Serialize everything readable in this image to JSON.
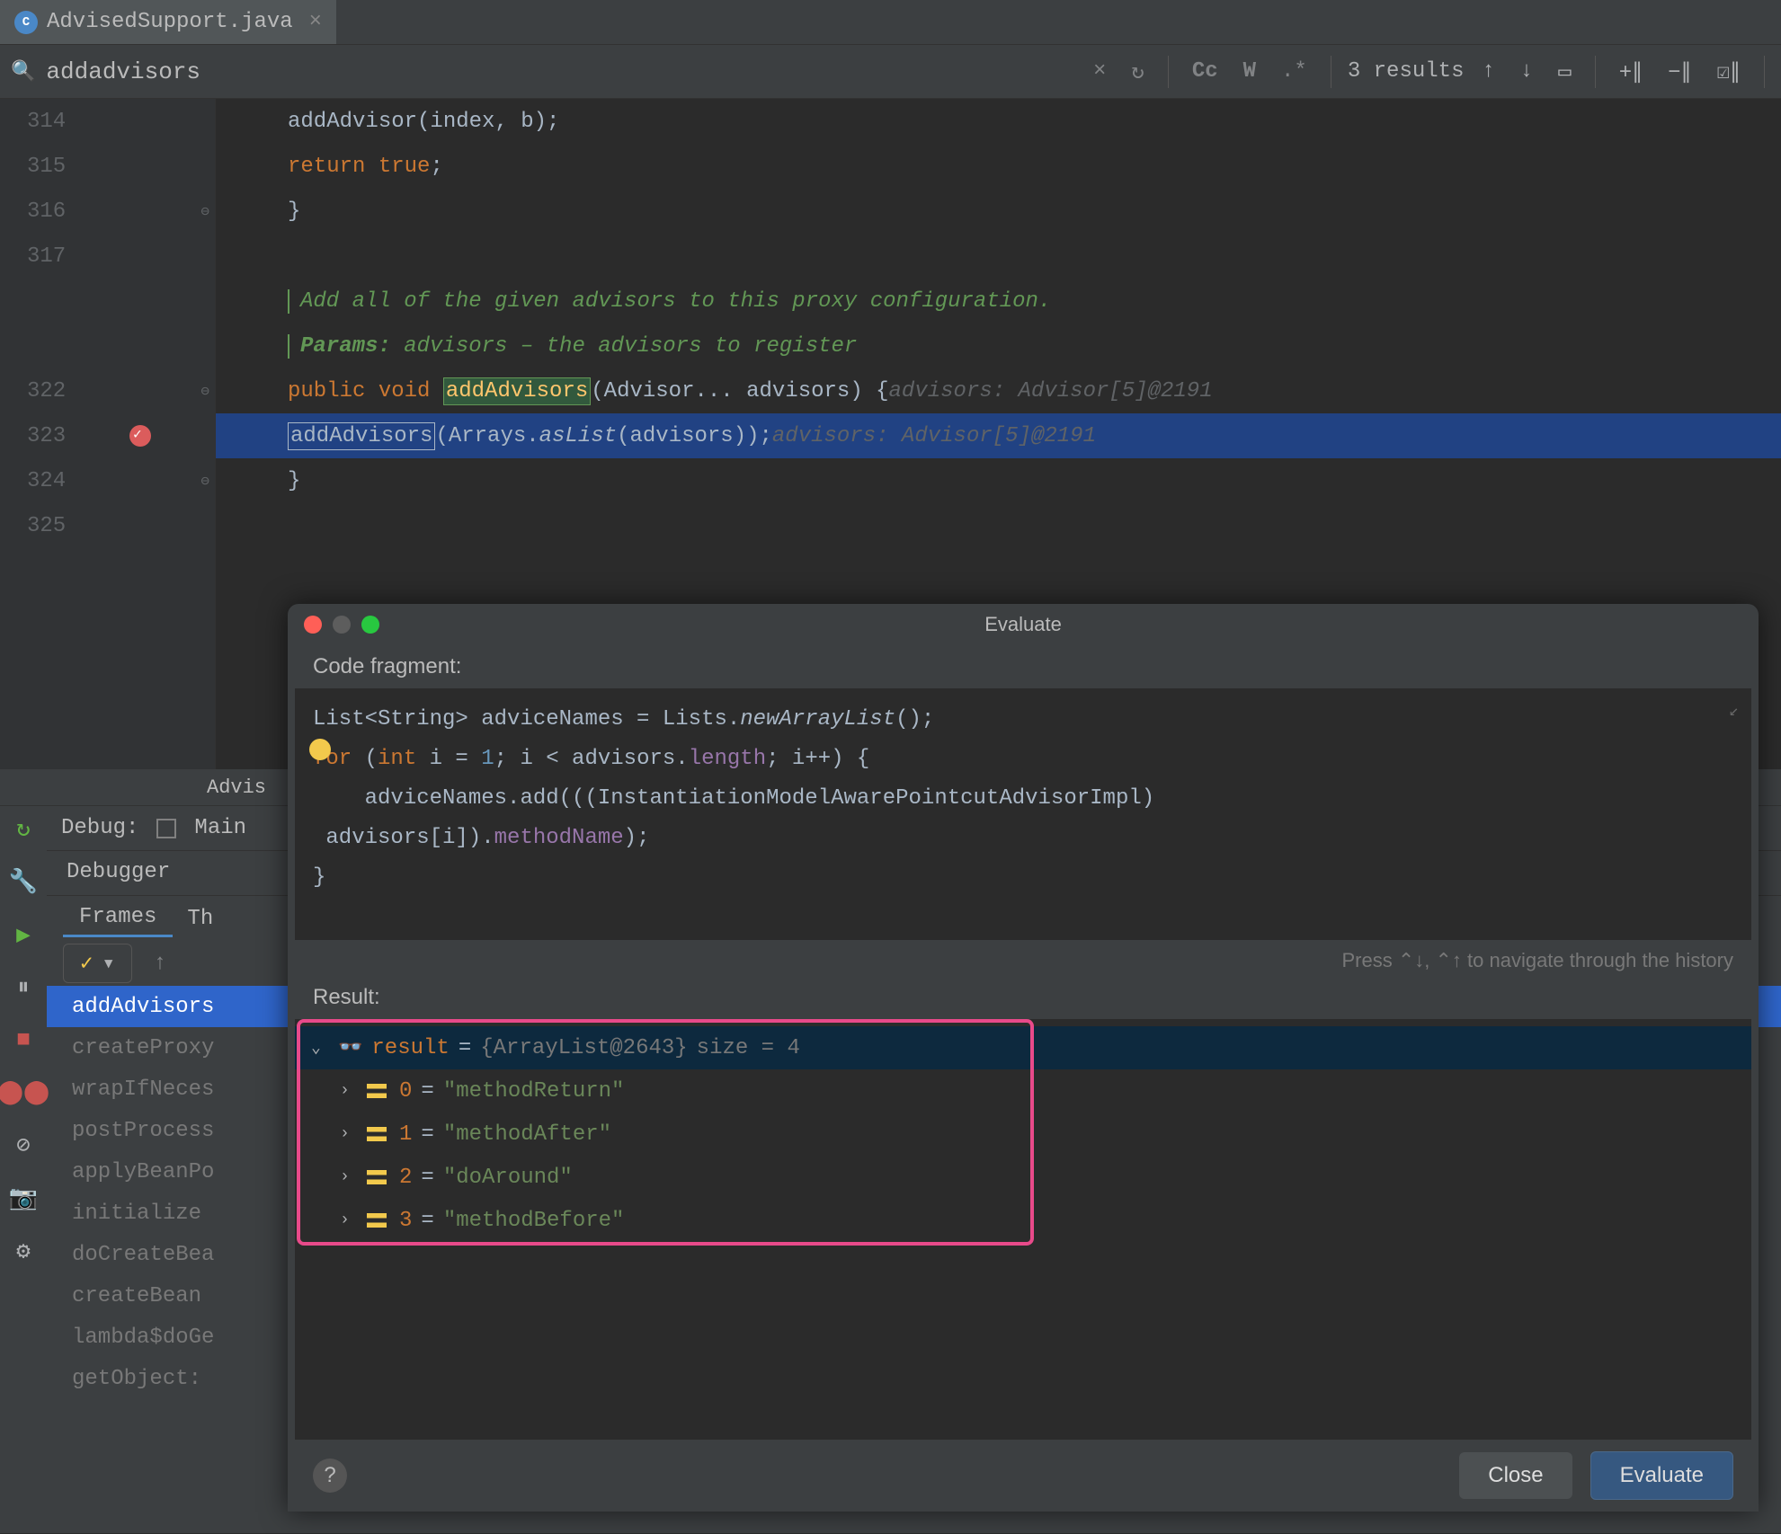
{
  "tab": {
    "label": "AdvisedSupport.java",
    "icon_letter": "C"
  },
  "search": {
    "query": "addadvisors",
    "results_text": "3 results"
  },
  "gutter_lines": [
    "314",
    "315",
    "316",
    "317",
    "",
    "",
    "322",
    "323",
    "324",
    "325"
  ],
  "code": {
    "l314_call": "addAdvisor(index, b);",
    "l315_ret": "return true;",
    "l316_brace": "}",
    "comment1": "Add all of the given advisors to this proxy configuration.",
    "comment2_key": "Params: ",
    "comment2_rest": "advisors – the advisors to register",
    "l322_kw": "public void ",
    "l322_method": "addAdvisors",
    "l322_sig": "(Advisor... advisors) {",
    "l322_hint": "advisors: Advisor[5]@2191",
    "l323_method": "addAdvisors",
    "l323_call_a": "(Arrays.",
    "l323_call_b": "asList",
    "l323_call_c": "(advisors));",
    "l323_hint": "advisors: Advisor[5]@2191",
    "l324_brace": "}"
  },
  "editor_footer_tab": "Advis",
  "debug": {
    "label": "Debug:",
    "config_name": "Main",
    "tab_debugger": "Debugger",
    "tab_frames": "Frames",
    "tab_threads": "Th",
    "frames": [
      "addAdvisors",
      "createProxy",
      "wrapIfNeces",
      "postProcess",
      "applyBeanPo",
      "initialize",
      "doCreateBea",
      "createBean",
      "lambda$doGe",
      "getObject:"
    ]
  },
  "evaluate": {
    "title": "Evaluate",
    "code_fragment_label": "Code fragment:",
    "cf_l1_a": "List<String> adviceNames = Lists.",
    "cf_l1_b": "newArrayList",
    "cf_l1_c": "();",
    "cf_l2": "for (int i = 1; i < advisors.length; i++) {",
    "cf_l3": "    adviceNames.add(((InstantiationModelAwarePointcutAdvisorImpl)",
    "cf_l4_a": " advisors[i]).",
    "cf_l4_b": "methodName",
    "cf_l4_c": ");",
    "cf_l5": "}",
    "nav_hint": "Press ⌃↓, ⌃↑ to navigate through the history",
    "result_label": "Result:",
    "result_root_name": "result",
    "result_root_type": "{ArrayList@2643}",
    "result_root_size": " size = 4",
    "items": [
      {
        "idx": "0",
        "val": "\"methodReturn\""
      },
      {
        "idx": "1",
        "val": "\"methodAfter\""
      },
      {
        "idx": "2",
        "val": "\"doAround\""
      },
      {
        "idx": "3",
        "val": "\"methodBefore\""
      }
    ],
    "close_btn": "Close",
    "evaluate_btn": "Evaluate"
  }
}
